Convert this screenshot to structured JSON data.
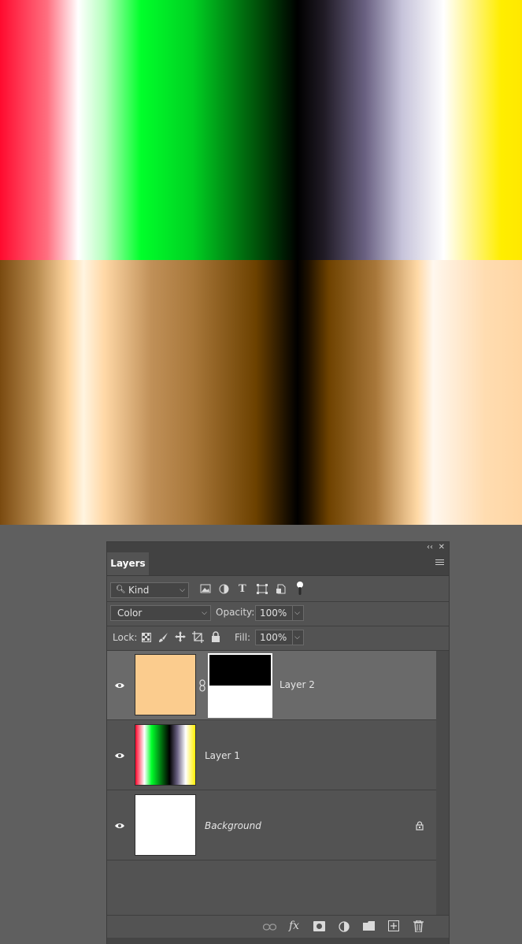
{
  "panel": {
    "tab_label": "Layers",
    "collapse_icon": "double-chevron-left-icon",
    "close_icon": "close-icon",
    "menu_icon": "hamburger-menu-icon"
  },
  "filter": {
    "kind_label": "Kind",
    "filter_icons": [
      "image-filter-icon",
      "adjustment-filter-icon",
      "type-filter-icon",
      "shape-filter-icon",
      "smart-object-filter-icon",
      "filter-toggle-icon"
    ]
  },
  "blend": {
    "mode": "Color",
    "opacity_label": "Opacity:",
    "opacity_value": "100%"
  },
  "lock": {
    "label": "Lock:",
    "fill_label": "Fill:",
    "fill_value": "100%"
  },
  "layers": [
    {
      "name": "Layer 2",
      "selected": true,
      "visible": true,
      "thumb_color": "#fbcc8e",
      "has_mask": true,
      "linked": true
    },
    {
      "name": "Layer 1",
      "selected": false,
      "visible": true
    },
    {
      "name": "Background",
      "selected": false,
      "visible": true,
      "locked": true,
      "italic": true
    }
  ],
  "footer": {
    "icons": [
      "link-layers-icon",
      "fx-icon",
      "add-mask-icon",
      "adjustment-layer-icon",
      "new-group-icon",
      "new-layer-icon",
      "delete-layer-icon"
    ],
    "fx_label": "fx"
  },
  "colors": {
    "panel_bg": "#535353",
    "selected_row": "#6a6a6a",
    "workspace": "#5f5f5f"
  }
}
